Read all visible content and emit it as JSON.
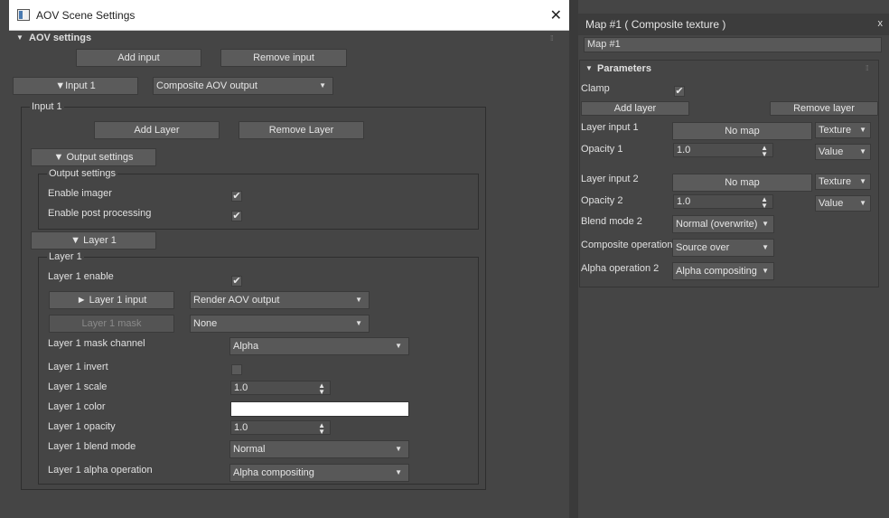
{
  "left_window": {
    "title": "AOV Scene Settings",
    "rollout_title": "AOV settings",
    "add_input": "Add input",
    "remove_input": "Remove input",
    "input_toggle": "▼Input 1",
    "input_dropdown": "Composite AOV output",
    "input_group": "Input 1",
    "add_layer": "Add Layer",
    "remove_layer": "Remove Layer",
    "output_toggle": "▼ Output settings",
    "output_group": "Output settings",
    "enable_imager": "Enable imager",
    "enable_post": "Enable post processing",
    "layer_toggle": "▼ Layer 1",
    "layer_group": "Layer 1",
    "layer_enable": "Layer 1 enable",
    "layer_input_btn": "► Layer 1 input",
    "layer_input_dd": "Render AOV output",
    "layer_mask_btn": "Layer 1 mask",
    "layer_mask_dd": "None",
    "mask_channel_label": "Layer 1 mask channel",
    "mask_channel_dd": "Alpha",
    "invert_label": "Layer 1 invert",
    "scale_label": "Layer 1 scale",
    "scale_value": "1.0",
    "color_label": "Layer 1 color",
    "opacity_label": "Layer 1 opacity",
    "opacity_value": "1.0",
    "blend_label": "Layer 1 blend mode",
    "blend_dd": "Normal",
    "alpha_label": "Layer 1 alpha operation",
    "alpha_dd": "Alpha compositing",
    "color_swatch": "#ffffff"
  },
  "right_window": {
    "title": "Map #1  ( Composite texture )",
    "close": "x",
    "name_field": "Map #1",
    "rollout_title": "Parameters",
    "clamp_label": "Clamp",
    "add_layer": "Add layer",
    "remove_layer": "Remove layer",
    "layer_input_1": "Layer input 1",
    "no_map_1": "No map",
    "texture_1": "Texture",
    "opacity_1_label": "Opacity 1",
    "opacity_1_value": "1.0",
    "value_1": "Value",
    "layer_input_2": "Layer input 2",
    "no_map_2": "No map",
    "texture_2": "Texture",
    "opacity_2_label": "Opacity 2",
    "opacity_2_value": "1.0",
    "value_2": "Value",
    "blend_mode_label": "Blend mode 2",
    "blend_mode_dd": "Normal (overwrite)",
    "composite_label": "Composite operation",
    "composite_dd": "Source over",
    "alpha_label": "Alpha operation 2",
    "alpha_dd": "Alpha compositing"
  },
  "icons": {
    "checkmark": "✔",
    "dropdown_arrow": "▼",
    "spinner_arrows": "▲▼",
    "close": "✕",
    "collapse": "▼"
  }
}
